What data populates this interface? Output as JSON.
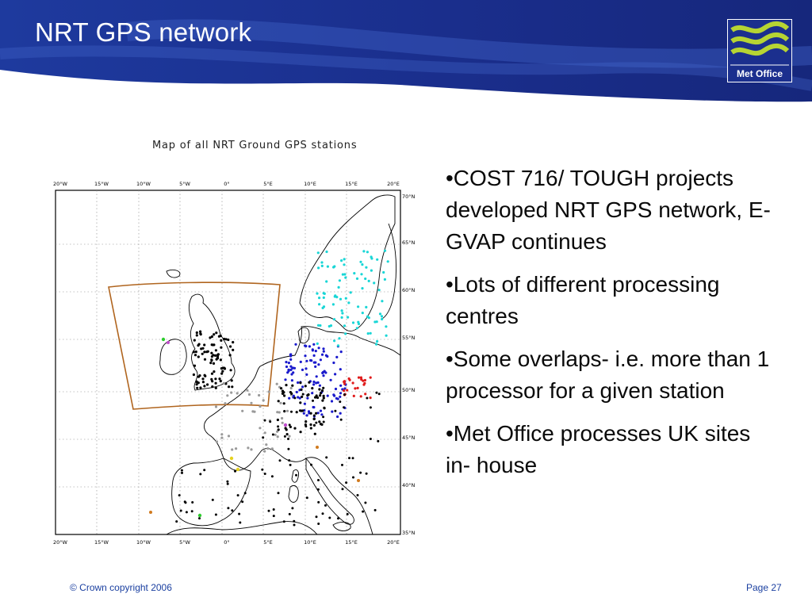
{
  "slide": {
    "title": "NRT GPS network",
    "logo_text": "Met Office",
    "colors": {
      "header_blue": "#1b2f8e",
      "logo_green": "#b6d433",
      "footer_text": "#1a3fa0"
    }
  },
  "map": {
    "caption": "Map of all NRT Ground GPS stations",
    "lon_labels": [
      "20°W",
      "15°W",
      "10°W",
      "5°W",
      "0°",
      "5°E",
      "10°E",
      "15°E",
      "20°E"
    ],
    "lat_labels": [
      "70°N",
      "65°N",
      "60°N",
      "55°N",
      "50°N",
      "45°N",
      "40°N",
      "35°N"
    ],
    "station_colors": {
      "uk": "#000000",
      "germany": "#1a1acc",
      "scandinavia": "#19d6d6",
      "czech": "#e01b1b",
      "france": "#9a9a9a",
      "misc": "#000000"
    }
  },
  "bullets": [
    "•COST 716/ TOUGH projects developed NRT GPS network, E-GVAP continues",
    "•Lots of different processing centres",
    "•Some overlaps- i.e. more than 1 processor for a given station",
    "•Met Office processes UK sites in- house"
  ],
  "footer": {
    "copyright": "© Crown copyright 2006",
    "page": "Page 27"
  }
}
